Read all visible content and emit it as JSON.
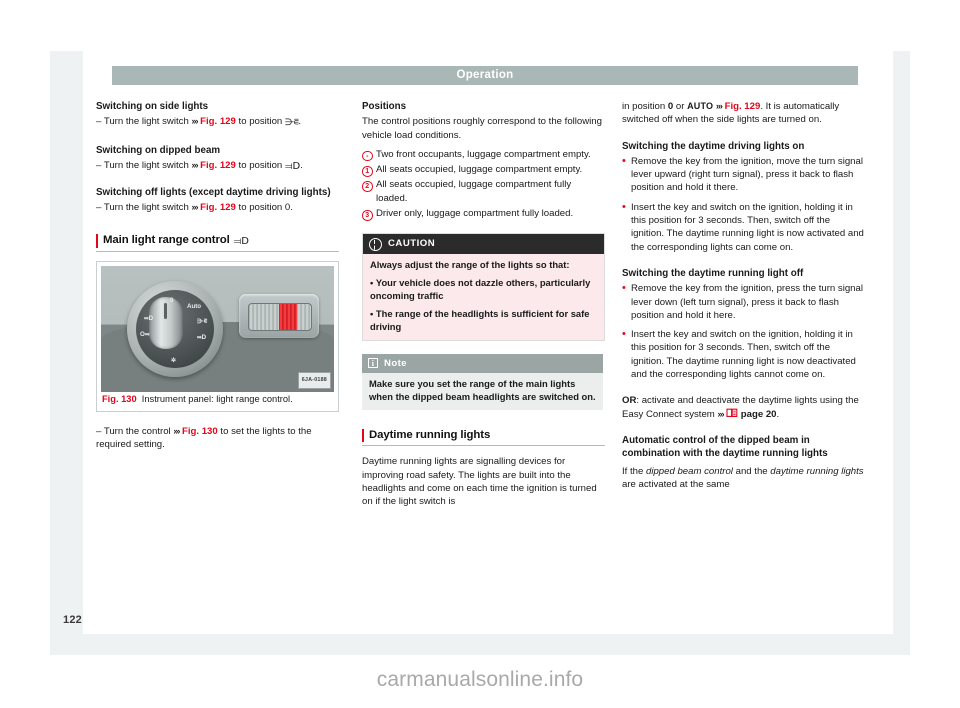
{
  "running_head": {
    "title": "Operation"
  },
  "page_number": "122",
  "watermark": "carmanualsonline.info",
  "colors": {
    "accent_red": "#e3051b",
    "head_bar": "#a9b8b6",
    "caution_head_bg": "#2b2b2b",
    "caution_body_bg": "#fbe9ec",
    "note_head_bg": "#9aa5a4",
    "note_body_bg": "#eceeee"
  },
  "col1": {
    "h1": "Switching on side lights",
    "b1_pre": "– Turn the light switch ",
    "b1_xref": "Fig. 129",
    "b1_post": " to position ",
    "b1_symbol": "side-lights-symbol",
    "b1_end": ".",
    "h2": "Switching on dipped beam",
    "b2_pre": "– Turn the light switch ",
    "b2_xref": "Fig. 129",
    "b2_post": " to position ",
    "b2_symbol": "dipped-beam-symbol",
    "b2_end": ".",
    "h3": "Switching off lights (except daytime driving lights)",
    "b3_pre": "– Turn the light switch ",
    "b3_xref": "Fig. 129",
    "b3_post": " to position 0.",
    "section_heading": "Main light range control",
    "figure": {
      "number": "Fig. 130",
      "caption": "Instrument panel: light range control.",
      "code": "6JA-0188",
      "knob_labels": [
        "0",
        "Auto",
        "≋",
        "≡D",
        "O≢",
        "|D",
        "✲"
      ]
    },
    "b4_pre": "– Turn the control ",
    "b4_xref": "Fig. 130",
    "b4_post": " to set the lights to the required setting."
  },
  "col2": {
    "h1": "Positions",
    "p1": "The control positions roughly correspond to the following vehicle load conditions.",
    "positions": [
      {
        "marker": "-",
        "text": "Two front occupants, luggage compartment empty."
      },
      {
        "marker": "1",
        "text": "All seats occupied, luggage compartment empty."
      },
      {
        "marker": "2",
        "text": "All seats occupied, luggage compartment fully loaded."
      },
      {
        "marker": "3",
        "text": "Driver only, luggage compartment fully loaded."
      }
    ],
    "caution": {
      "title": "CAUTION",
      "lead": "Always adjust the range of the lights so that:",
      "bullets": [
        "Your vehicle does not dazzle others, particularly oncoming traffic",
        "The range of the headlights is sufficient for safe driving"
      ]
    },
    "note": {
      "title": "Note",
      "text": "Make sure you set the range of the main lights when the dipped beam headlights are switched on."
    },
    "section_heading": "Daytime running lights",
    "p2": "Daytime running lights are signalling devices for improving road safety. The lights are built into the headlights and come on each time the ignition is turned on if the light switch is"
  },
  "col3": {
    "p1_pre": "in position ",
    "p1_zero": "0",
    "p1_or": " or ",
    "p1_auto": "AUTO",
    "p1_xref": "Fig. 129",
    "p1_post": ". It is automatically switched off when the side lights are turned on.",
    "h1": "Switching the daytime driving lights on",
    "b1": "Remove the key from the ignition, move the turn signal lever upward (right turn signal), press it back to flash position and hold it there.",
    "b2": "Insert the key and switch on the ignition, holding it in this position for 3 seconds. Then, switch off the ignition. The daytime running light is now activated and the corresponding lights can come on.",
    "h2": "Switching the daytime running light off",
    "b3": "Remove the key from the ignition, press the turn signal lever down (left turn signal), press it back to flash position and hold it here.",
    "b4": "Insert the key and switch on the ignition, holding it in this position for 3 seconds. Then, switch off the ignition. The daytime running light is now deactivated and the corresponding lights cannot come on.",
    "or_label": "OR",
    "or_text": ": activate and deactivate the daytime lights using the Easy Connect system ",
    "or_page": " page 20",
    "or_end": ".",
    "h3": "Automatic control of the dipped beam in combination with the daytime running lights",
    "p2_pre": "If the ",
    "p2_i1": "dipped beam control",
    "p2_mid": " and the ",
    "p2_i2": "daytime running lights",
    "p2_post": " are activated at the same"
  }
}
